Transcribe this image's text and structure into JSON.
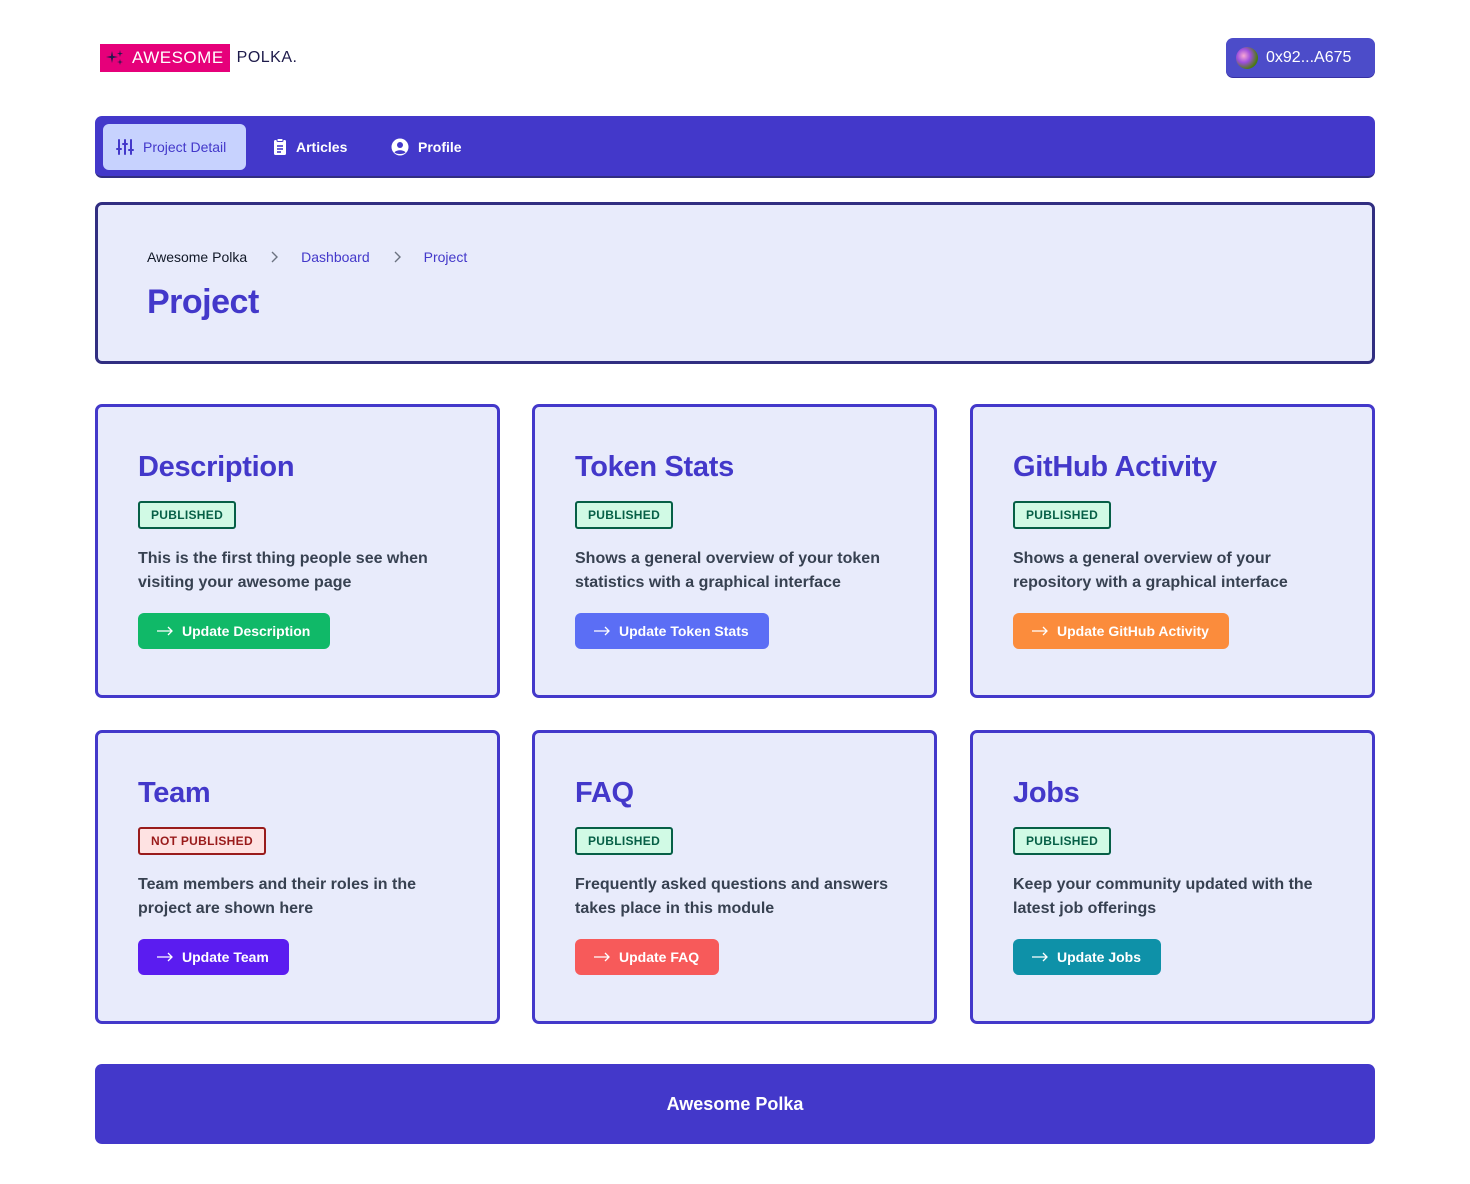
{
  "brand": {
    "logo_mark_text": "AWESOME",
    "logo_text": "POLKA.",
    "accent": "#e6007a"
  },
  "wallet": {
    "address": "0x92...A675"
  },
  "nav": {
    "items": [
      {
        "label": "Project Detail",
        "icon": "sliders-icon",
        "active": true
      },
      {
        "label": "Articles",
        "icon": "clipboard-icon",
        "active": false
      },
      {
        "label": "Profile",
        "icon": "user-circle-icon",
        "active": false
      }
    ]
  },
  "header": {
    "breadcrumb": [
      "Awesome Polka",
      "Dashboard",
      "Project"
    ],
    "title": "Project"
  },
  "cards": [
    {
      "title": "Description",
      "status": "PUBLISHED",
      "description": "This is the first thing people see when visiting your awesome page",
      "button": "Update Description",
      "color": "#10b968"
    },
    {
      "title": "Token Stats",
      "status": "PUBLISHED",
      "description": "Shows a general overview of your token statistics with a graphical interface",
      "button": "Update Token Stats",
      "color": "#5b6ef5"
    },
    {
      "title": "GitHub Activity",
      "status": "PUBLISHED",
      "description": "Shows a general overview of your repository with a graphical interface",
      "button": "Update GitHub Activity",
      "color": "#fb8c3c"
    },
    {
      "title": "Team",
      "status": "NOT PUBLISHED",
      "description": "Team members and their roles in the project are shown here",
      "button": "Update Team",
      "color": "#5b1cf0"
    },
    {
      "title": "FAQ",
      "status": "PUBLISHED",
      "description": "Frequently asked questions and answers takes place in this module",
      "button": "Update FAQ",
      "color": "#f75a5a"
    },
    {
      "title": "Jobs",
      "status": "PUBLISHED",
      "description": "Keep your community updated with the latest job offerings",
      "button": "Update Jobs",
      "color": "#0e91a8"
    }
  ],
  "footer": {
    "text": "Awesome Polka"
  }
}
